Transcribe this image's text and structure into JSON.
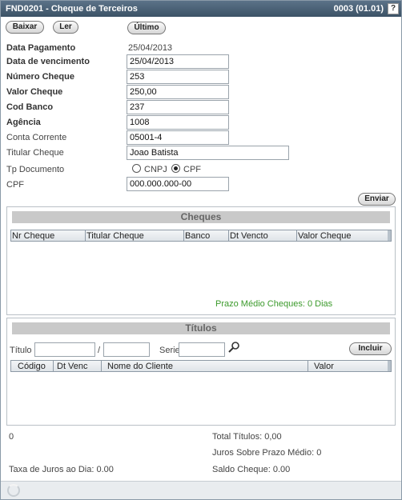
{
  "titlebar": {
    "left": "FND0201 - Cheque de Terceiros",
    "right": "0003 (01.01)",
    "help": "?"
  },
  "toolbar": {
    "baixar": "Baixar",
    "ler": "Ler",
    "ultimo": "Último"
  },
  "form": {
    "data_pagamento": {
      "label": "Data Pagamento",
      "value": "25/04/2013"
    },
    "data_vencimento": {
      "label": "Data de vencimento",
      "value": "25/04/2013"
    },
    "numero_cheque": {
      "label": "Número Cheque",
      "value": "253"
    },
    "valor_cheque": {
      "label": "Valor Cheque",
      "value": "250,00"
    },
    "cod_banco": {
      "label": "Cod Banco",
      "value": "237"
    },
    "agencia": {
      "label": "Agência",
      "value": "1008"
    },
    "conta_corrente": {
      "label": "Conta Corrente",
      "value": "05001-4"
    },
    "titular_cheque": {
      "label": "Titular Cheque",
      "value": "Joao Batista"
    },
    "tp_documento": {
      "label": "Tp Documento",
      "option_cnpj": "CNPJ",
      "option_cpf": "CPF",
      "selected": "CPF"
    },
    "cpf": {
      "label": "CPF",
      "value": "000.000.000-00"
    },
    "enviar": "Enviar"
  },
  "cheques": {
    "title": "Cheques",
    "columns": [
      "Nr Cheque",
      "Titular Cheque",
      "Banco",
      "Dt Vencto",
      "Valor Cheque"
    ],
    "prazo_medio": "Prazo Médio Cheques: 0 Dias"
  },
  "titulos": {
    "title": "Títulos",
    "titulo_label": "Título",
    "slash": "/",
    "serie_label": "Serie",
    "incluir": "Incluir",
    "columns": [
      "Código",
      "Dt Venc",
      "Nome do Cliente",
      "Valor"
    ]
  },
  "summary": {
    "count": "0",
    "total_titulos": "Total Títulos: 0,00",
    "juros_prazo": "Juros Sobre Prazo Médio: 0",
    "taxa_juros": "Taxa de Juros ao Dia: 0.00",
    "saldo_cheque": "Saldo Cheque: 0.00"
  },
  "colors": {
    "title_bar": "#3c5266",
    "accent_green": "#3b9a2b",
    "panel_header": "#c9c9c9"
  }
}
